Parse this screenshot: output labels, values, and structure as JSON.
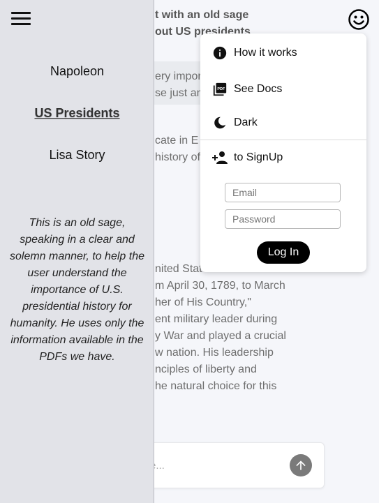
{
  "background": {
    "header_lines": [
      "t with an old sage",
      "out US presidents"
    ],
    "user_bubble_lines": [
      "ery import",
      "se just an"
    ],
    "reply_lines": [
      "cate in E",
      "history of"
    ],
    "answer_lines": [
      "nited Stat",
      "m April 30, 1789, to March",
      "her of His Country,\"",
      "ent military leader during",
      "y War and played a crucial",
      "w nation. His leadership",
      "nciples of liberty and",
      "he natural choice for this"
    ],
    "input_placeholder": "e..."
  },
  "sidebar": {
    "items": [
      {
        "label": "Napoleon",
        "active": false
      },
      {
        "label": "US Presidents",
        "active": true
      },
      {
        "label": "Lisa Story",
        "active": false
      }
    ],
    "description": "This is an old sage, speaking in a clear and solemn manner, to help the user understand the importance of U.S. presidential history for humanity. He uses only the information available in the PDFs we have."
  },
  "menu": {
    "how_it_works": "How it works",
    "see_docs": "See Docs",
    "dark": "Dark",
    "signup": "to SignUp",
    "email_placeholder": "Email",
    "password_placeholder": "Password",
    "login_label": "Log In"
  },
  "icons": {
    "hamburger": "menu-icon",
    "info": "info-icon",
    "pdf": "pdf-icon",
    "moon": "moon-icon",
    "add_person": "person-add-icon",
    "send": "arrow-up-icon",
    "smiley": "smiley-icon"
  }
}
